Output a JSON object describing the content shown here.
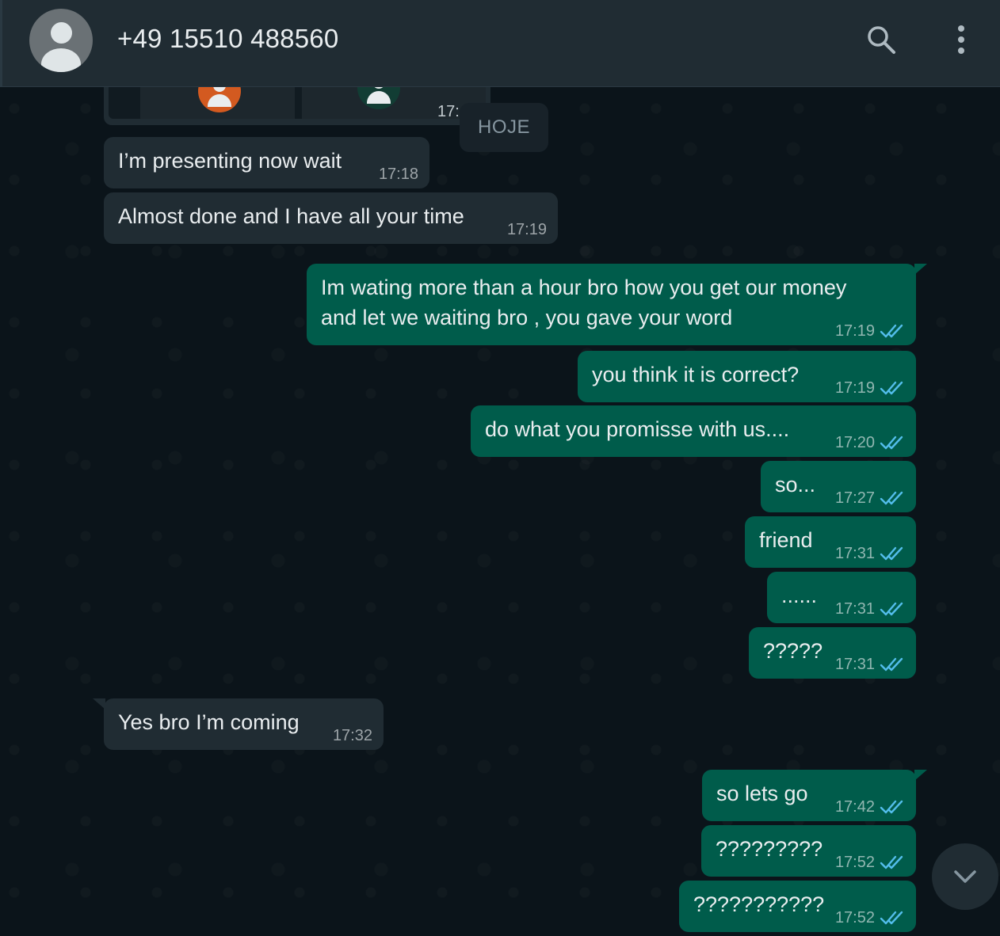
{
  "header": {
    "contact_name": "+49 15510 488560",
    "search_icon": "search-icon",
    "menu_icon": "kebab-menu-icon"
  },
  "media_message": {
    "time": "17:",
    "avatar_colors": [
      "#d35a20",
      "#123d34"
    ]
  },
  "date_chip": "HOJE",
  "messages": [
    {
      "dir": "in",
      "text": "I’m presenting now wait",
      "time": "17:18"
    },
    {
      "dir": "in",
      "text": "Almost done and I have all your time",
      "time": "17:19"
    },
    {
      "dir": "out",
      "lines": [
        "Im wating more than a hour bro how you get our money",
        "and let we waiting bro , you gave your word"
      ],
      "time": "17:19",
      "status": "read"
    },
    {
      "dir": "out",
      "text": "you think it is correct?",
      "time": "17:19",
      "status": "read"
    },
    {
      "dir": "out",
      "text": "do what you promisse with us....",
      "time": "17:20",
      "status": "read"
    },
    {
      "dir": "out",
      "text": "so...",
      "time": "17:27",
      "status": "read"
    },
    {
      "dir": "out",
      "text": "friend",
      "time": "17:31",
      "status": "read"
    },
    {
      "dir": "out",
      "text": "......",
      "time": "17:31",
      "status": "read"
    },
    {
      "dir": "out",
      "text": "?????",
      "time": "17:31",
      "status": "read"
    },
    {
      "dir": "in",
      "text": "Yes bro I’m coming",
      "time": "17:32"
    },
    {
      "dir": "out",
      "text": "so lets go",
      "time": "17:42",
      "status": "read"
    },
    {
      "dir": "out",
      "text": "?????????",
      "time": "17:52",
      "status": "read"
    },
    {
      "dir": "out",
      "text": "???????????",
      "time": "17:52",
      "status": "read"
    }
  ],
  "colors": {
    "header_bg": "#202c33",
    "chat_bg": "#0b141a",
    "incoming_bubble": "#202c33",
    "outgoing_bubble": "#005c4b",
    "read_ticks": "#53bdeb"
  },
  "scroll_down_icon": "chevron-down-icon"
}
